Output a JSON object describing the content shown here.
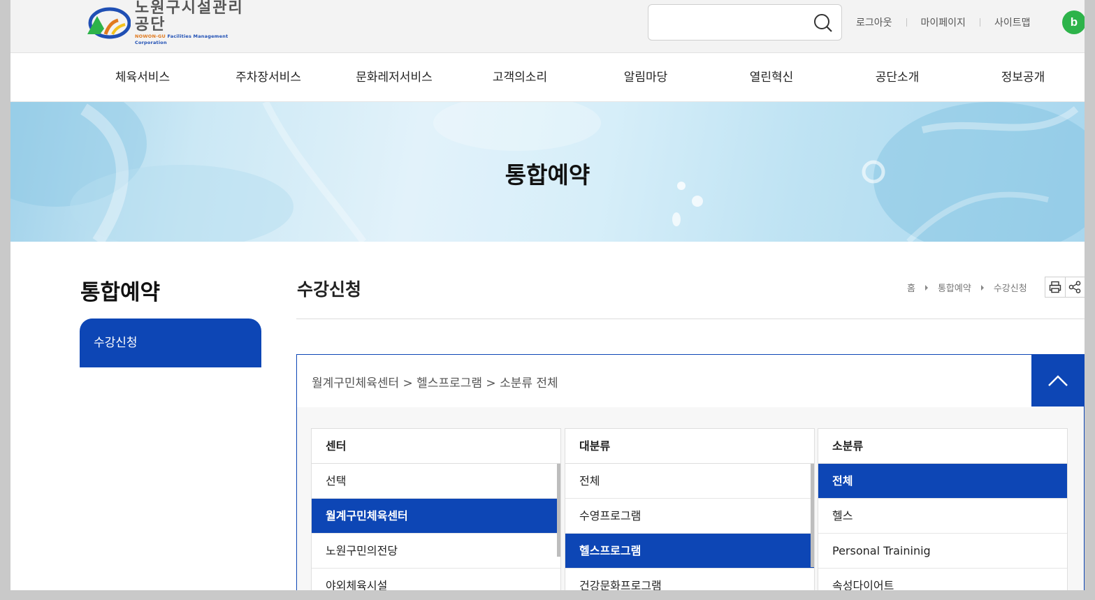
{
  "header": {
    "logo_ko": "노원구시설관리공단",
    "logo_en_prefix": "NOWON-GU",
    "logo_en_suffix": "Facilities  Management Corporation",
    "search_placeholder": "",
    "links": [
      "로그아웃",
      "마이페이지",
      "사이트맵"
    ],
    "extension_badge": "b",
    "extension_badge_color": "#2db34a"
  },
  "gnb": {
    "items": [
      "체육서비스",
      "주차장서비스",
      "문화레저서비스",
      "고객의소리",
      "알림마당",
      "열린혁신",
      "공단소개",
      "정보공개"
    ]
  },
  "banner": {
    "title": "통합예약"
  },
  "sidebar": {
    "title": "통합예약",
    "items": [
      "수강신청"
    ]
  },
  "content": {
    "title": "수강신청",
    "breadcrumb": [
      "홈",
      "통합예약",
      "수강신청"
    ],
    "tools": [
      "print-icon",
      "share-icon"
    ]
  },
  "panel": {
    "path": "월계구민체육센터 > 헬스프로그램 > 소분류 전체",
    "accent_color": "#0d46b5",
    "columns": [
      {
        "header": "센터",
        "items": [
          "선택",
          "월계구민체육센터",
          "노원구민의전당",
          "야외체육시설"
        ],
        "selected": "월계구민체육센터"
      },
      {
        "header": "대분류",
        "items": [
          "전체",
          "수영프로그램",
          "헬스프로그램",
          "건강문화프로그램"
        ],
        "selected": "헬스프로그램"
      },
      {
        "header": "소분류",
        "items": [
          "전체",
          "헬스",
          "Personal Traininig",
          "속성다이어트"
        ],
        "selected": "전체"
      }
    ]
  }
}
